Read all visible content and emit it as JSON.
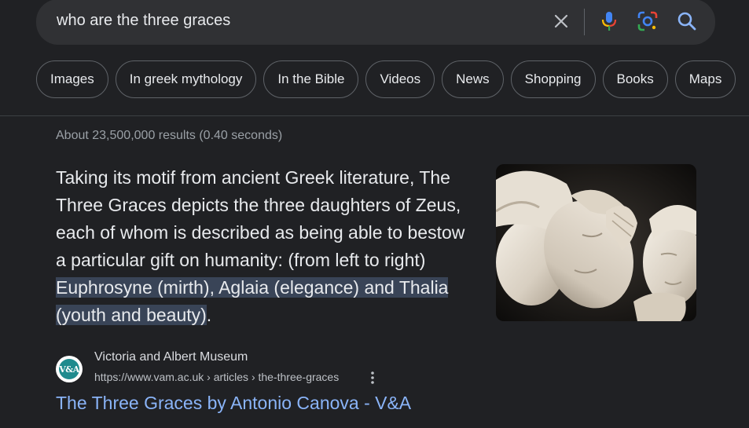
{
  "search": {
    "query": "who are the three graces"
  },
  "icons": {
    "clear": "close-icon",
    "mic": "microphone-icon",
    "lens": "google-lens-icon",
    "search": "search-icon"
  },
  "chips": [
    {
      "label": "Images"
    },
    {
      "label": "In greek mythology"
    },
    {
      "label": "In the Bible"
    },
    {
      "label": "Videos"
    },
    {
      "label": "News"
    },
    {
      "label": "Shopping"
    },
    {
      "label": "Books"
    },
    {
      "label": "Maps"
    }
  ],
  "results_stats": "About 23,500,000 results (0.40 seconds)",
  "featured_snippet": {
    "text_plain": "Taking its motif from ancient Greek literature, The Three Graces depicts the three daughters of Zeus, each of whom is described as being able to bestow a particular gift on humanity: (from left to right) ",
    "text_highlighted": "Euphrosyne (mirth), Aglaia (elegance) and Thalia (youth and beauty)",
    "text_end": "."
  },
  "source": {
    "site_name": "Victoria and Albert Museum",
    "url": "https://www.vam.ac.uk › articles › the-three-graces",
    "favicon_text": "V&A"
  },
  "result_title": "The Three Graces by Antonio Canova - V&A",
  "colors": {
    "background": "#202124",
    "search_bar": "#303134",
    "link": "#8ab4f8",
    "highlight": "#394457",
    "favicon_teal": "#1f8b8e"
  }
}
